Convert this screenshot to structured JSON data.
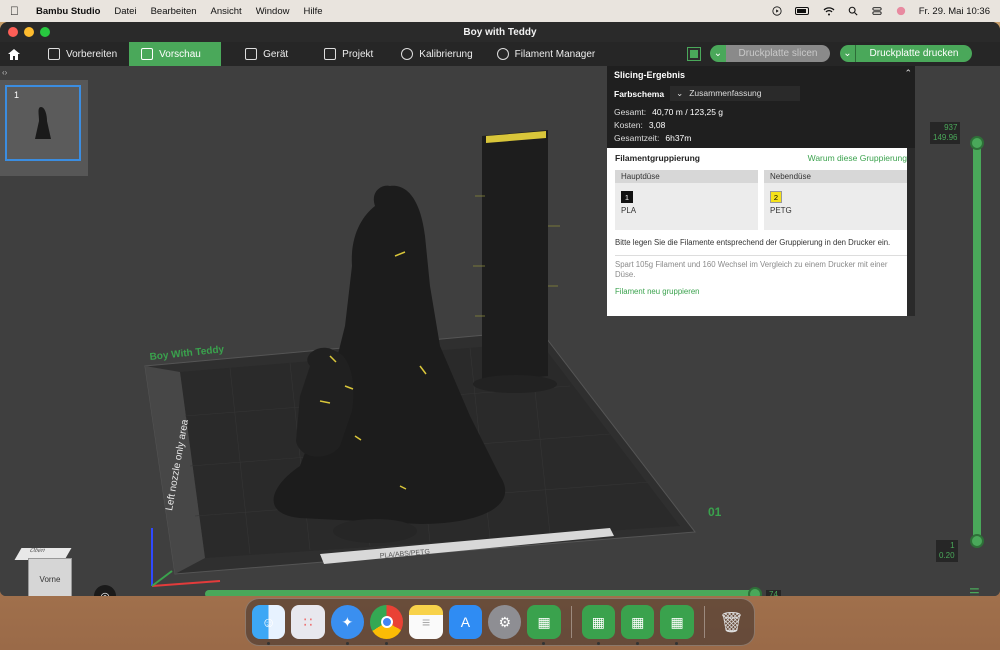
{
  "menubar": {
    "app_name": "Bambu Studio",
    "items": [
      "Datei",
      "Bearbeiten",
      "Ansicht",
      "Window",
      "Hilfe"
    ],
    "clock": "Fr. 29. Mai  10:36"
  },
  "window": {
    "title": "Boy with Teddy"
  },
  "toolbar": {
    "tabs": [
      {
        "label": "Vorbereiten",
        "icon": "cube-icon"
      },
      {
        "label": "Vorschau",
        "icon": "layers-icon"
      },
      {
        "label": "Gerät",
        "icon": "device-icon"
      },
      {
        "label": "Projekt",
        "icon": "project-icon"
      },
      {
        "label": "Kalibrierung",
        "icon": "calibration-icon"
      },
      {
        "label": "Filament Manager",
        "icon": "filament-icon"
      }
    ],
    "active_tab": "Vorschau",
    "slice_label": "Druckplatte slicen",
    "print_label": "Druckplatte drucken"
  },
  "plate": {
    "thumb_number": "1",
    "plate_label": "Boy With Teddy",
    "plate_number": "01",
    "left_area_label": "Left nozzle only area",
    "bed_text": "PLA/ABS/PETG"
  },
  "slicing_result": {
    "title": "Slicing-Ergebnis",
    "color_scheme_label": "Farbschema",
    "color_scheme_value": "Zusammenfassung",
    "stats": [
      {
        "label": "Gesamt:",
        "value": "40,70 m / 123,25 g"
      },
      {
        "label": "Kosten:",
        "value": "3,08"
      },
      {
        "label": "Gesamtzeit:",
        "value": "6h37m"
      }
    ],
    "grouping_title": "Filamentgruppierung",
    "grouping_link": "Warum diese Gruppierung",
    "main_nozzle": {
      "header": "Hauptdüse",
      "slot": "1",
      "material": "PLA",
      "color": "#111111"
    },
    "side_nozzle": {
      "header": "Nebendüse",
      "slot": "2",
      "material": "PETG",
      "color": "#f5e21a"
    },
    "note": "Bitte legen Sie die Filamente entsprechend der Gruppierung in den Drucker ein.",
    "savings": "Spart 105g Filament und 160 Wechsel im Vergleich zu einem Drucker mit einer Düse.",
    "regroup_link": "Filament neu gruppieren"
  },
  "layer_slider": {
    "top_layer": "937",
    "top_height": "149.96",
    "bottom_layer": "1",
    "bottom_height": "0.20",
    "move_value": "74"
  },
  "view_cube": {
    "top_label": "Oben",
    "front_label": "Vorne"
  },
  "dock": {
    "apps": [
      "Finder",
      "Launchpad",
      "Safari",
      "Chrome",
      "Notes",
      "App Store",
      "System Settings",
      "Bambu Studio",
      "Bambu Studio",
      "Bambu Studio",
      "Bambu Studio",
      "Trash"
    ]
  }
}
